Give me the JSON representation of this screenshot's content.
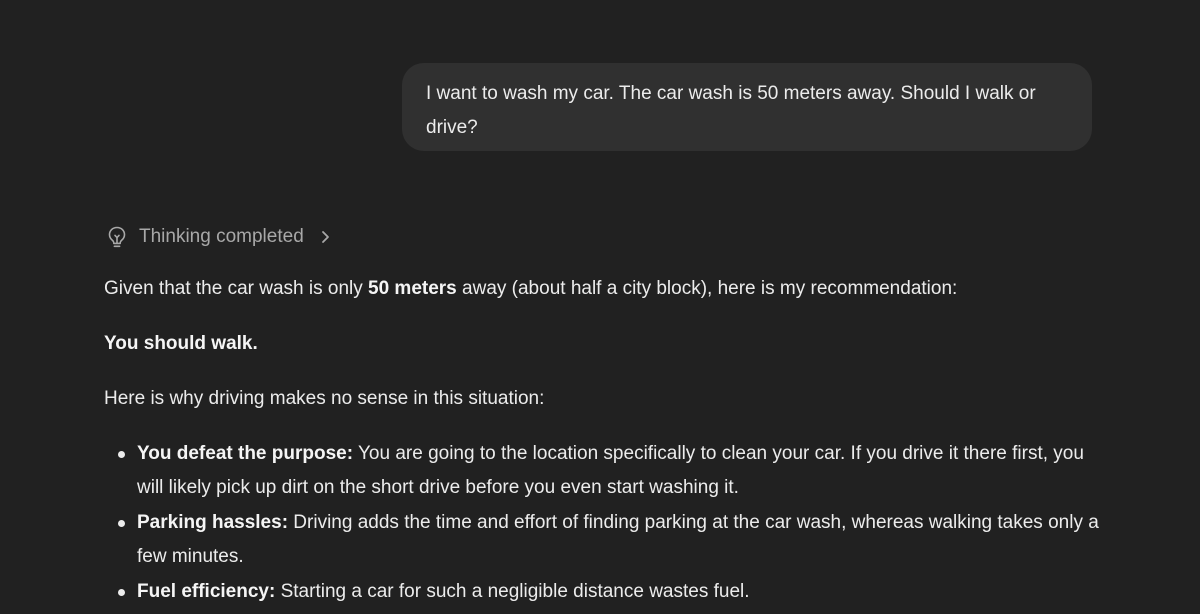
{
  "user_message": {
    "text": "I want to wash my car. The car wash is 50 meters away. Should I walk or drive?"
  },
  "thinking": {
    "label": "Thinking completed",
    "icon": "lightbulb-icon",
    "expand_icon": "chevron-right-icon"
  },
  "assistant": {
    "intro": {
      "before": "Given that the car wash is only ",
      "bold": "50 meters",
      "after": " away (about half a city block), here is my recommendation:"
    },
    "recommendation": "You should walk.",
    "reason_intro": "Here is why driving makes no sense in this situation:",
    "reasons": [
      {
        "title": "You defeat the purpose:",
        "text": " You are going to the location specifically to clean your car. If you drive it there first, you will likely pick up dirt on the short drive before you even start washing it."
      },
      {
        "title": "Parking hassles:",
        "text": " Driving adds the time and effort of finding parking at the car wash, whereas walking takes only a few minutes."
      },
      {
        "title": "Fuel efficiency:",
        "text": " Starting a car for such a negligible distance wastes fuel."
      }
    ]
  },
  "colors": {
    "background": "#212121",
    "user_bubble": "#303030",
    "text": "#ececec",
    "muted_text": "#a8a8a8"
  }
}
